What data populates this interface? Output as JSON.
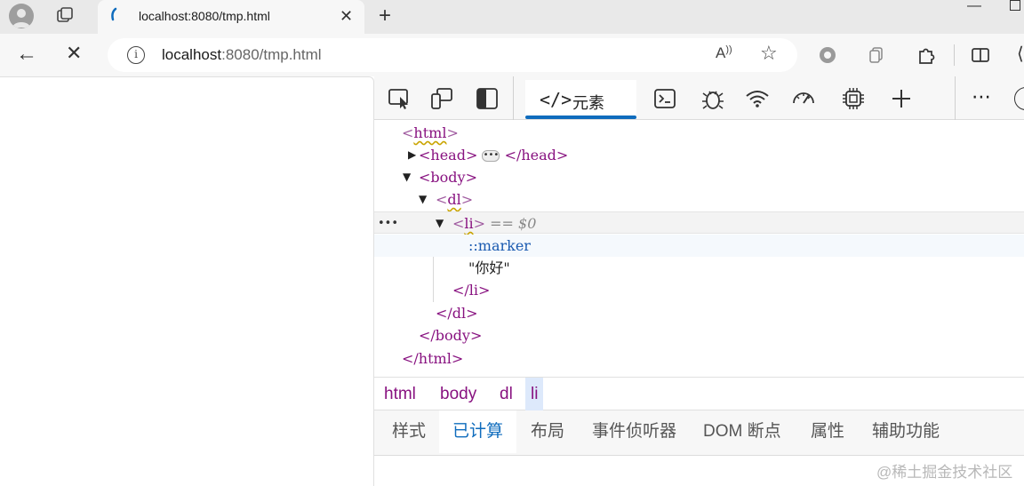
{
  "tab": {
    "title": "localhost:8080/tmp.html",
    "close": "✕",
    "new_tab": "+"
  },
  "address": {
    "host": "localhost",
    "rest": ":8080/tmp.html",
    "read_aloud": "A",
    "favorite": "☆",
    "info": "i"
  },
  "nav": {
    "back": "←",
    "stop": "✕"
  },
  "devtools": {
    "elements_tab": {
      "icon": "</>",
      "label": "元素"
    },
    "dom": {
      "html_open": {
        "lt": "<",
        "name": "html",
        "gt": ">"
      },
      "head_open": "<head>",
      "head_ellipsis": "•••",
      "head_close": "</head>",
      "body_open": "<body>",
      "dl_open": {
        "lt": "<",
        "name": "dl",
        "gt": ">"
      },
      "li_open": {
        "lt": "<",
        "name": "li",
        "gt": ">"
      },
      "li_selected_marker": "== $0",
      "row_dots": "•••",
      "marker": "::marker",
      "text": "\"你好\"",
      "li_close": "</li>",
      "dl_close": "</dl>",
      "body_close": "</body>",
      "html_close": "</html>"
    },
    "breadcrumb": [
      "html",
      "body",
      "dl",
      "li"
    ],
    "sub_tabs": [
      "样式",
      "已计算",
      "布局",
      "事件侦听器",
      "DOM 断点",
      "属性",
      "辅助功能"
    ]
  },
  "watermark": "@稀土掘金技术社区",
  "colors": {
    "accent": "#0f6cbd",
    "tag": "#881280",
    "pseudo": "#1a5ab0"
  }
}
